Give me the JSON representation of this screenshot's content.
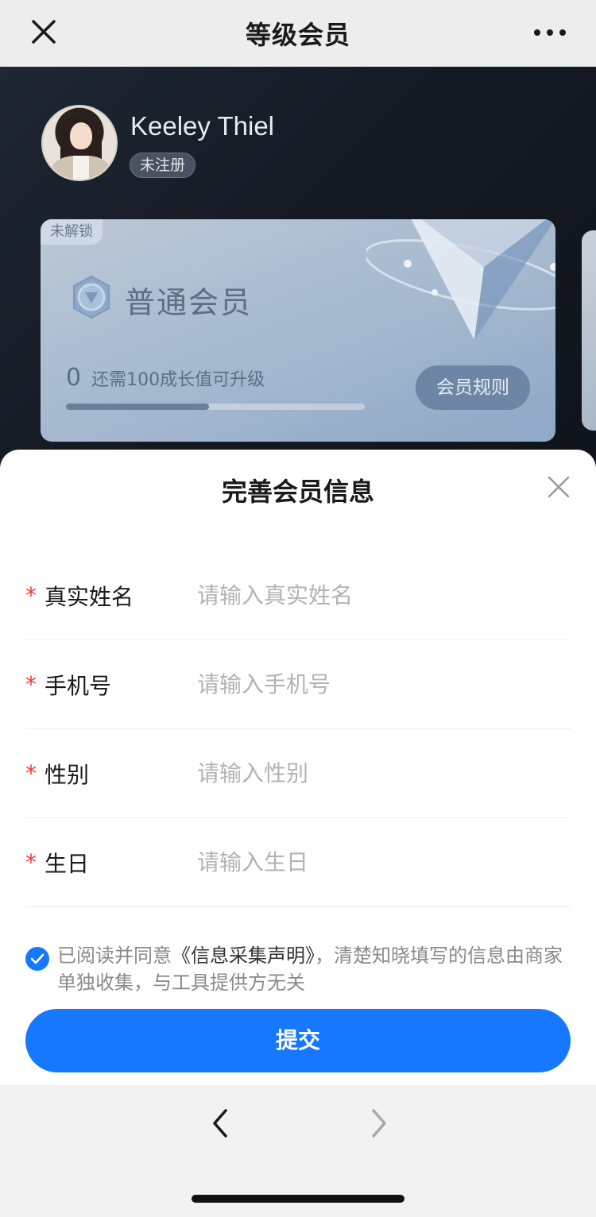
{
  "topbar": {
    "title": "等级会员"
  },
  "profile": {
    "name": "Keeley Thiel",
    "status_badge": "未注册"
  },
  "member_card": {
    "lock_label": "未解锁",
    "level_name": "普通会员",
    "growth_value": "0",
    "growth_text": "还需100成长值可升级",
    "progress_fraction": 0.48,
    "rules_button": "会员规则"
  },
  "sheet": {
    "title": "完善会员信息",
    "fields": [
      {
        "required_mark": "*",
        "label": "真实姓名",
        "placeholder": "请输入真实姓名"
      },
      {
        "required_mark": "*",
        "label": "手机号",
        "placeholder": "请输入手机号"
      },
      {
        "required_mark": "*",
        "label": "性别",
        "placeholder": "请输入性别"
      },
      {
        "required_mark": "*",
        "label": "生日",
        "placeholder": "请输入生日"
      }
    ],
    "agreement": {
      "checked": true,
      "prefix": "已阅读并同意",
      "link": "《信息采集声明》",
      "suffix": "，清楚知晓填写的信息由商家单独收集，与工具提供方无关"
    },
    "submit_label": "提交"
  },
  "colors": {
    "accent": "#1677ff",
    "required": "#f03a3a"
  },
  "icons": [
    "close-icon",
    "more-icon",
    "medal-icon",
    "check-icon",
    "chevron-left-icon",
    "chevron-right-icon"
  ]
}
